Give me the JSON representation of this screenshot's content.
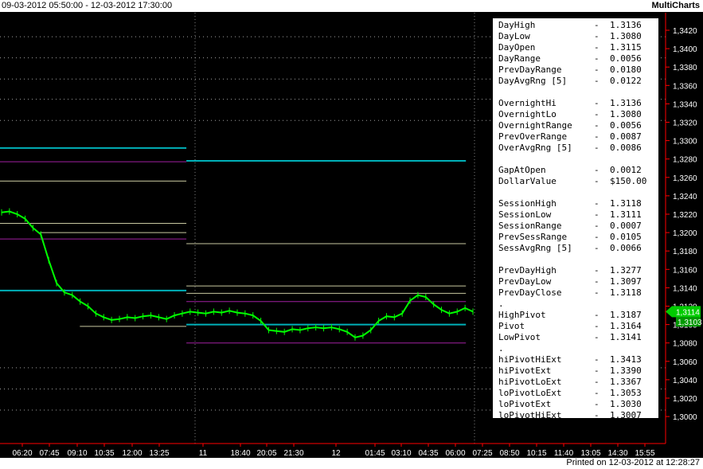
{
  "header": {
    "range": "09-03-2012 05:50:00 - 12-03-2012 17:30:00",
    "brand": "MultiCharts"
  },
  "footer": {
    "printed": "Printed on 12-03-2012 at 12:28:27"
  },
  "colors": {
    "background": "#000000",
    "price": "#00ff00",
    "cyan_level": "#00b0b8",
    "magenta_level": "#a020a0",
    "tan_level": "#c8c8a0",
    "grid": "#808080",
    "axis": "#ff0000",
    "last_price_tag": "#00cc00"
  },
  "stats": [
    {
      "label": "DayHigh",
      "value": "1.3136"
    },
    {
      "label": "DayLow",
      "value": "1.3080"
    },
    {
      "label": "DayOpen",
      "value": "1.3115"
    },
    {
      "label": "DayRange",
      "value": "0.0056"
    },
    {
      "label": "PrevDayRange",
      "value": "0.0180"
    },
    {
      "label": "DayAvgRng [5]",
      "value": "0.0122"
    },
    {
      "label": "",
      "value": ""
    },
    {
      "label": "OvernightHi",
      "value": "1.3136"
    },
    {
      "label": "OvernightLo",
      "value": "1.3080"
    },
    {
      "label": "OvernightRange",
      "value": "0.0056"
    },
    {
      "label": "PrevOverRange",
      "value": "0.0087"
    },
    {
      "label": "OverAvgRng [5]",
      "value": "0.0086"
    },
    {
      "label": "",
      "value": ""
    },
    {
      "label": "GapAtOpen",
      "value": "0.0012"
    },
    {
      "label": "DollarValue",
      "value": "$150.00"
    },
    {
      "label": "",
      "value": ""
    },
    {
      "label": "SessionHigh",
      "value": "1.3118"
    },
    {
      "label": "SessionLow",
      "value": "1.3111"
    },
    {
      "label": "SessionRange",
      "value": "0.0007"
    },
    {
      "label": "PrevSessRange",
      "value": "0.0105"
    },
    {
      "label": "SessAvgRng [5]",
      "value": "0.0066"
    },
    {
      "label": "",
      "value": ""
    },
    {
      "label": "PrevDayHigh",
      "value": "1.3277"
    },
    {
      "label": "PrevDayLow",
      "value": "1.3097"
    },
    {
      "label": "PrevDayClose",
      "value": "1.3118"
    },
    {
      "label": ".",
      "value": "",
      "dot": true
    },
    {
      "label": "HighPivot",
      "value": "1.3187"
    },
    {
      "label": "Pivot",
      "value": "1.3164"
    },
    {
      "label": "LowPivot",
      "value": "1.3141"
    },
    {
      "label": ".",
      "value": "",
      "dot": true
    },
    {
      "label": "hiPivotHiExt",
      "value": "1.3413"
    },
    {
      "label": "hiPivotExt",
      "value": "1.3390"
    },
    {
      "label": "hiPivotLoExt",
      "value": "1.3367"
    },
    {
      "label": "loPivotLoExt",
      "value": "1.3053"
    },
    {
      "label": "loPivotExt",
      "value": "1.3030"
    },
    {
      "label": "loPivotHiExt",
      "value": "1.3007"
    }
  ],
  "chart_data": {
    "type": "line",
    "ylim": [
      1.3,
      1.3436
    ],
    "y_ticks": [
      "1,3420",
      "1,3400",
      "1,3380",
      "1,3360",
      "1,3340",
      "1,3320",
      "1,3300",
      "1,3280",
      "1,3260",
      "1,3240",
      "1,3220",
      "1,3200",
      "1,3180",
      "1,3160",
      "1,3140",
      "1,3120",
      "1,3100",
      "1,3080",
      "1,3060",
      "1,3040",
      "1,3020",
      "1,3000"
    ],
    "x_ticks": [
      "06:20",
      "07:45",
      "09:10",
      "10:35",
      "12:00",
      "13:25",
      "11",
      "18:40",
      "20:05",
      "21:30",
      "12",
      "01:45",
      "03:10",
      "04:35",
      "06:00",
      "07:25",
      "08:50",
      "10:15",
      "11:40",
      "13:05",
      "14:30",
      "15:55"
    ],
    "last_price": "1,3114",
    "second_tag": "1,3103",
    "series": [
      {
        "values": [
          1.3222,
          1.3223,
          1.322,
          1.3215,
          1.3205,
          1.3198,
          1.317,
          1.3145,
          1.3135,
          1.3132,
          1.3125,
          1.312,
          1.3112,
          1.3108,
          1.3105,
          1.3106,
          1.3108,
          1.3107,
          1.3109,
          1.311,
          1.3108,
          1.3106,
          1.311,
          1.3112,
          1.3114,
          1.3113,
          1.3112,
          1.3114,
          1.3113,
          1.3115,
          1.3113,
          1.3112,
          1.311,
          1.3104,
          1.3094,
          1.3093,
          1.3092,
          1.3095,
          1.3094,
          1.3096,
          1.3097,
          1.3096,
          1.3097,
          1.3095,
          1.3092,
          1.3086,
          1.3088,
          1.3094,
          1.3104,
          1.3109,
          1.3108,
          1.3112,
          1.3126,
          1.3132,
          1.313,
          1.3122,
          1.3116,
          1.3112,
          1.3114,
          1.3118,
          1.3114
        ]
      }
    ],
    "levels": [
      {
        "color": "cyan_level",
        "segments": [
          [
            0,
            0.28,
            1.3292
          ],
          [
            0.28,
            0.7,
            1.3278
          ],
          [
            0,
            0.28,
            1.3137
          ],
          [
            0.28,
            0.7,
            1.31
          ]
        ]
      },
      {
        "color": "magenta_level",
        "segments": [
          [
            0,
            0.28,
            1.3277
          ],
          [
            0,
            0.28,
            1.3193
          ],
          [
            0.28,
            0.7,
            1.3125
          ],
          [
            0.28,
            0.7,
            1.308
          ]
        ]
      },
      {
        "color": "tan_level",
        "segments": [
          [
            0,
            0.28,
            1.3256
          ],
          [
            0,
            0.28,
            1.321
          ],
          [
            0.06,
            0.28,
            1.32
          ],
          [
            0.28,
            0.7,
            1.3188
          ],
          [
            0.28,
            0.7,
            1.3142
          ],
          [
            0.28,
            0.7,
            1.3134
          ],
          [
            0.12,
            0.28,
            1.3098
          ]
        ]
      }
    ],
    "dotted_levels": [
      1.3413,
      1.339,
      1.3367,
      1.3345,
      1.3322,
      1.3053,
      1.303,
      1.3007
    ]
  }
}
